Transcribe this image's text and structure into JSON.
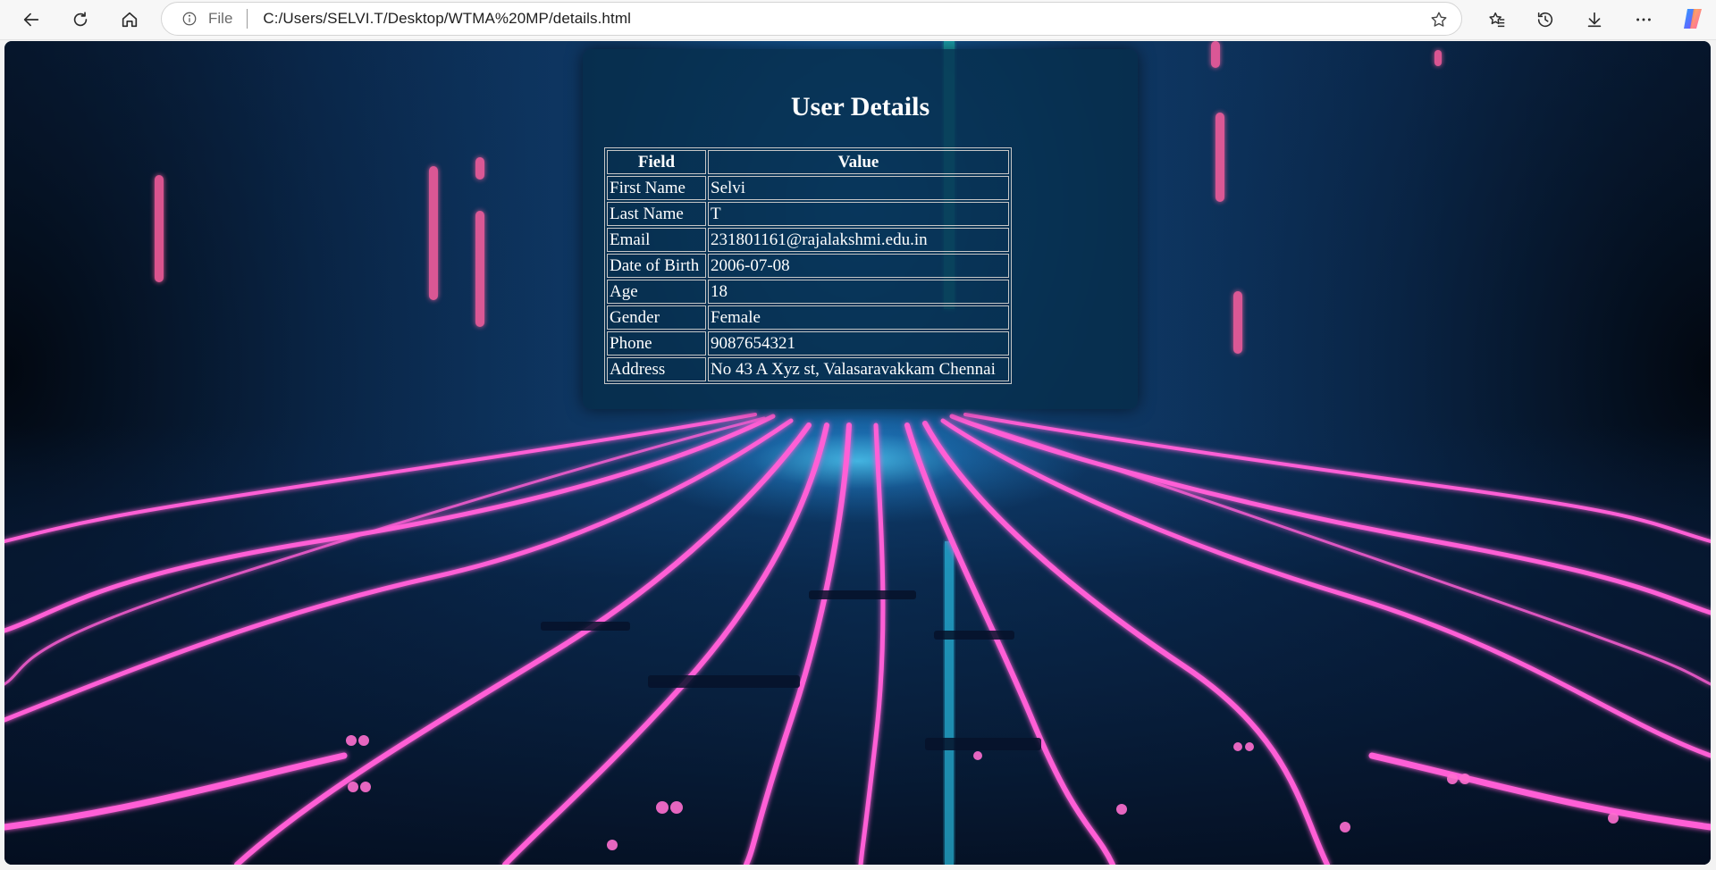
{
  "browser": {
    "address_prefix": "File",
    "url": "C:/Users/SELVI.T/Desktop/WTMA%20MP/details.html",
    "icons": [
      "back-icon",
      "refresh-icon",
      "home-icon",
      "info-icon",
      "favorite-star-icon",
      "favorites-icon",
      "history-icon",
      "download-icon",
      "more-icon",
      "copilot-icon"
    ]
  },
  "page": {
    "title": "User Details",
    "table": {
      "headers": [
        "Field",
        "Value"
      ],
      "rows": [
        {
          "field": "First Name",
          "value": "Selvi"
        },
        {
          "field": "Last Name",
          "value": "T"
        },
        {
          "field": "Email",
          "value": "231801161@rajalakshmi.edu.in"
        },
        {
          "field": "Date of Birth",
          "value": "2006-07-08"
        },
        {
          "field": "Age",
          "value": "18"
        },
        {
          "field": "Gender",
          "value": "Female"
        },
        {
          "field": "Phone",
          "value": "9087654321"
        },
        {
          "field": "Address",
          "value": "No 43 A Xyz st, Valasaravakkam Chennai"
        }
      ]
    }
  },
  "colors": {
    "card_bg": "#062d4b",
    "neon_pink": "#ff4fd8",
    "neon_cyan": "#3fd4ff",
    "background_dark": "#07152b"
  }
}
